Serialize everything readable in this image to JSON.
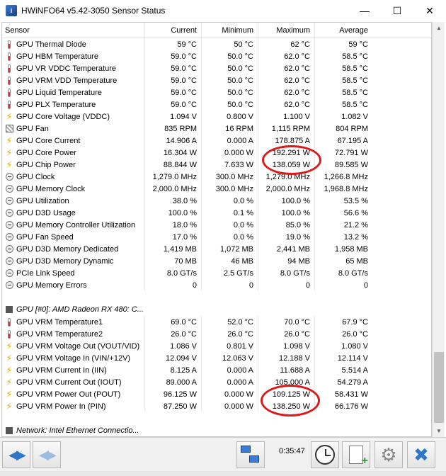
{
  "window": {
    "title": "HWiNFO64 v5.42-3050 Sensor Status",
    "app_icon": "hwinfo-icon"
  },
  "columns": [
    "Sensor",
    "Current",
    "Minimum",
    "Maximum",
    "Average"
  ],
  "groups": [
    {
      "label": "",
      "rows": [
        {
          "icon": "temp",
          "name": "GPU Thermal Diode",
          "current": "59 °C",
          "minimum": "50 °C",
          "maximum": "62 °C",
          "average": "59 °C"
        },
        {
          "icon": "temp",
          "name": "GPU HBM Temperature",
          "current": "59.0 °C",
          "minimum": "50.0 °C",
          "maximum": "62.0 °C",
          "average": "58.5 °C"
        },
        {
          "icon": "temp",
          "name": "GPU VR VDDC Temperature",
          "current": "59.0 °C",
          "minimum": "50.0 °C",
          "maximum": "62.0 °C",
          "average": "58.5 °C"
        },
        {
          "icon": "temp",
          "name": "GPU VRM VDD Temperature",
          "current": "59.0 °C",
          "minimum": "50.0 °C",
          "maximum": "62.0 °C",
          "average": "58.5 °C"
        },
        {
          "icon": "temp",
          "name": "GPU Liquid Temperature",
          "current": "59.0 °C",
          "minimum": "50.0 °C",
          "maximum": "62.0 °C",
          "average": "58.5 °C"
        },
        {
          "icon": "temp",
          "name": "GPU PLX Temperature",
          "current": "59.0 °C",
          "minimum": "50.0 °C",
          "maximum": "62.0 °C",
          "average": "58.5 °C"
        },
        {
          "icon": "volt",
          "name": "GPU Core Voltage (VDDC)",
          "current": "1.094 V",
          "minimum": "0.800 V",
          "maximum": "1.100 V",
          "average": "1.082 V"
        },
        {
          "icon": "fan",
          "name": "GPU Fan",
          "current": "835 RPM",
          "minimum": "16 RPM",
          "maximum": "1,115 RPM",
          "average": "804 RPM"
        },
        {
          "icon": "volt",
          "name": "GPU Core Current",
          "current": "14.906 A",
          "minimum": "0.000 A",
          "maximum": "178.875 A",
          "average": "67.195 A"
        },
        {
          "icon": "volt",
          "name": "GPU Core Power",
          "current": "16.304 W",
          "minimum": "0.000 W",
          "maximum": "192.291 W",
          "average": "72.791 W"
        },
        {
          "icon": "volt",
          "name": "GPU Chip Power",
          "current": "88.844 W",
          "minimum": "7.633 W",
          "maximum": "138.059 W",
          "average": "89.585 W"
        },
        {
          "icon": "clock",
          "name": "GPU Clock",
          "current": "1,279.0 MHz",
          "minimum": "300.0 MHz",
          "maximum": "1,279.0 MHz",
          "average": "1,266.8 MHz"
        },
        {
          "icon": "clock",
          "name": "GPU Memory Clock",
          "current": "2,000.0 MHz",
          "minimum": "300.0 MHz",
          "maximum": "2,000.0 MHz",
          "average": "1,968.8 MHz"
        },
        {
          "icon": "clock",
          "name": "GPU Utilization",
          "current": "38.0 %",
          "minimum": "0.0 %",
          "maximum": "100.0 %",
          "average": "53.5 %"
        },
        {
          "icon": "clock",
          "name": "GPU D3D Usage",
          "current": "100.0 %",
          "minimum": "0.1 %",
          "maximum": "100.0 %",
          "average": "56.6 %"
        },
        {
          "icon": "clock",
          "name": "GPU Memory Controller Utilization",
          "current": "18.0 %",
          "minimum": "0.0 %",
          "maximum": "85.0 %",
          "average": "21.2 %"
        },
        {
          "icon": "clock",
          "name": "GPU Fan Speed",
          "current": "17.0 %",
          "minimum": "0.0 %",
          "maximum": "19.0 %",
          "average": "13.2 %"
        },
        {
          "icon": "clock",
          "name": "GPU D3D Memory Dedicated",
          "current": "1,419 MB",
          "minimum": "1,072 MB",
          "maximum": "2,441 MB",
          "average": "1,958 MB"
        },
        {
          "icon": "clock",
          "name": "GPU D3D Memory Dynamic",
          "current": "70 MB",
          "minimum": "46 MB",
          "maximum": "94 MB",
          "average": "65 MB"
        },
        {
          "icon": "clock",
          "name": "PCIe Link Speed",
          "current": "8.0 GT/s",
          "minimum": "2.5 GT/s",
          "maximum": "8.0 GT/s",
          "average": "8.0 GT/s"
        },
        {
          "icon": "clock",
          "name": "GPU Memory Errors",
          "current": "0",
          "minimum": "0",
          "maximum": "0",
          "average": "0"
        }
      ]
    },
    {
      "label": "GPU [#0]: AMD Radeon RX 480: C...",
      "rows": [
        {
          "icon": "temp",
          "name": "GPU VRM Temperature1",
          "current": "69.0 °C",
          "minimum": "52.0 °C",
          "maximum": "70.0 °C",
          "average": "67.9 °C"
        },
        {
          "icon": "temp",
          "name": "GPU VRM Temperature2",
          "current": "26.0 °C",
          "minimum": "26.0 °C",
          "maximum": "26.0 °C",
          "average": "26.0 °C"
        },
        {
          "icon": "volt",
          "name": "GPU VRM Voltage Out (VOUT/VID)",
          "current": "1.086 V",
          "minimum": "0.801 V",
          "maximum": "1.098 V",
          "average": "1.080 V"
        },
        {
          "icon": "volt",
          "name": "GPU VRM Voltage In (VIN/+12V)",
          "current": "12.094 V",
          "minimum": "12.063 V",
          "maximum": "12.188 V",
          "average": "12.114 V"
        },
        {
          "icon": "volt",
          "name": "GPU VRM Current In (IIN)",
          "current": "8.125 A",
          "minimum": "0.000 A",
          "maximum": "11.688 A",
          "average": "5.514 A"
        },
        {
          "icon": "volt",
          "name": "GPU VRM Current Out (IOUT)",
          "current": "89.000 A",
          "minimum": "0.000 A",
          "maximum": "105.000 A",
          "average": "54.279 A"
        },
        {
          "icon": "volt",
          "name": "GPU VRM Power Out (POUT)",
          "current": "96.125 W",
          "minimum": "0.000 W",
          "maximum": "109.125 W",
          "average": "58.431 W"
        },
        {
          "icon": "volt",
          "name": "GPU VRM Power In (PIN)",
          "current": "87.250 W",
          "minimum": "0.000 W",
          "maximum": "138.250 W",
          "average": "66.176 W"
        }
      ]
    },
    {
      "label": "Network: Intel Ethernet Connectio...",
      "rows": []
    }
  ],
  "toolbar": {
    "elapsed_time": "0:35:47"
  },
  "colors": {
    "highlight_ellipse": "#d81b1b",
    "accent": "#2f78c8"
  }
}
